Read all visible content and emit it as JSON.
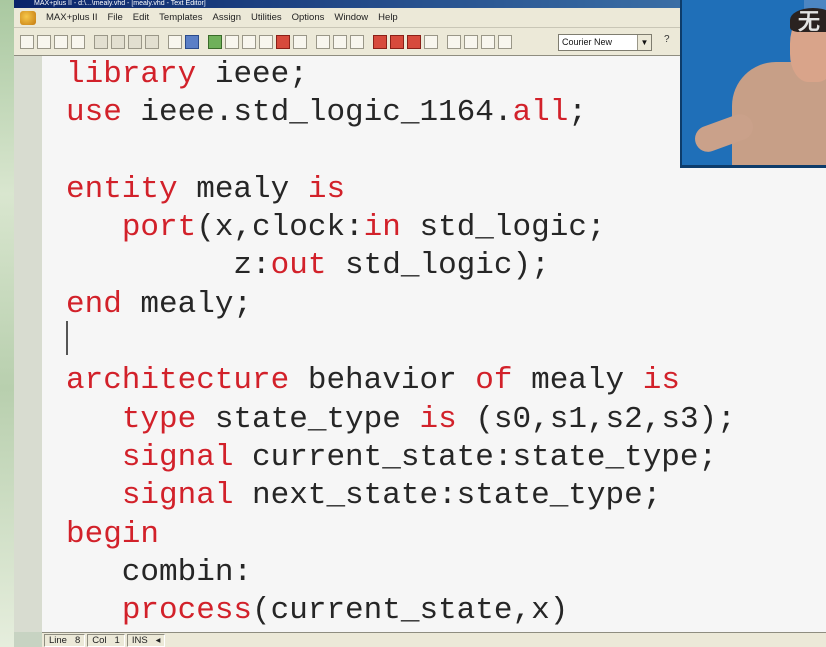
{
  "window": {
    "title": "MAX+plus II - d:\\...\\mealy.vhd - [mealy.vhd - Text Editor]"
  },
  "menu": {
    "items": [
      "MAX+plus II",
      "File",
      "Edit",
      "Templates",
      "Assign",
      "Utilities",
      "Options",
      "Window",
      "Help"
    ]
  },
  "toolbar": {
    "font_select": "Courier New",
    "help_glyph": "?"
  },
  "editor": {
    "lines": [
      [
        {
          "t": "library",
          "k": true
        },
        {
          "t": " ieee;",
          "k": false
        }
      ],
      [
        {
          "t": "use",
          "k": true
        },
        {
          "t": " ieee.std_logic_1164.",
          "k": false
        },
        {
          "t": "all",
          "k": true
        },
        {
          "t": ";",
          "k": false
        }
      ],
      [],
      [
        {
          "t": "entity",
          "k": true
        },
        {
          "t": " mealy ",
          "k": false
        },
        {
          "t": "is",
          "k": true
        }
      ],
      [
        {
          "t": "   ",
          "k": false
        },
        {
          "t": "port",
          "k": true
        },
        {
          "t": "(x,clock:",
          "k": false
        },
        {
          "t": "in",
          "k": true
        },
        {
          "t": " std_logic;",
          "k": false
        }
      ],
      [
        {
          "t": "         z:",
          "k": false
        },
        {
          "t": "out",
          "k": true
        },
        {
          "t": " std_logic);",
          "k": false
        }
      ],
      [
        {
          "t": "end",
          "k": true
        },
        {
          "t": " mealy;",
          "k": false
        }
      ],
      [],
      [
        {
          "t": "architecture",
          "k": true
        },
        {
          "t": " behavior ",
          "k": false
        },
        {
          "t": "of",
          "k": true
        },
        {
          "t": " mealy ",
          "k": false
        },
        {
          "t": "is",
          "k": true
        }
      ],
      [
        {
          "t": "   ",
          "k": false
        },
        {
          "t": "type",
          "k": true
        },
        {
          "t": " state_type ",
          "k": false
        },
        {
          "t": "is",
          "k": true
        },
        {
          "t": " (s0,s1,s2,s3);",
          "k": false
        }
      ],
      [
        {
          "t": "   ",
          "k": false
        },
        {
          "t": "signal",
          "k": true
        },
        {
          "t": " current_state:state_type;",
          "k": false
        }
      ],
      [
        {
          "t": "   ",
          "k": false
        },
        {
          "t": "signal",
          "k": true
        },
        {
          "t": " next_state:state_type;",
          "k": false
        }
      ],
      [
        {
          "t": "begin",
          "k": true
        }
      ],
      [
        {
          "t": "   combin:",
          "k": false
        }
      ],
      [
        {
          "t": "   ",
          "k": false
        },
        {
          "t": "process",
          "k": true
        },
        {
          "t": "(current_state,x)",
          "k": false
        }
      ]
    ]
  },
  "status": {
    "line_label": "Line",
    "line_value": "8",
    "col_label": "Col",
    "col_value": "1",
    "mode": "INS"
  },
  "webcam": {
    "overlay_text": "无"
  },
  "colors": {
    "keyword": "#d2212a",
    "text": "#262626",
    "editor_bg": "#f6f6f6"
  }
}
